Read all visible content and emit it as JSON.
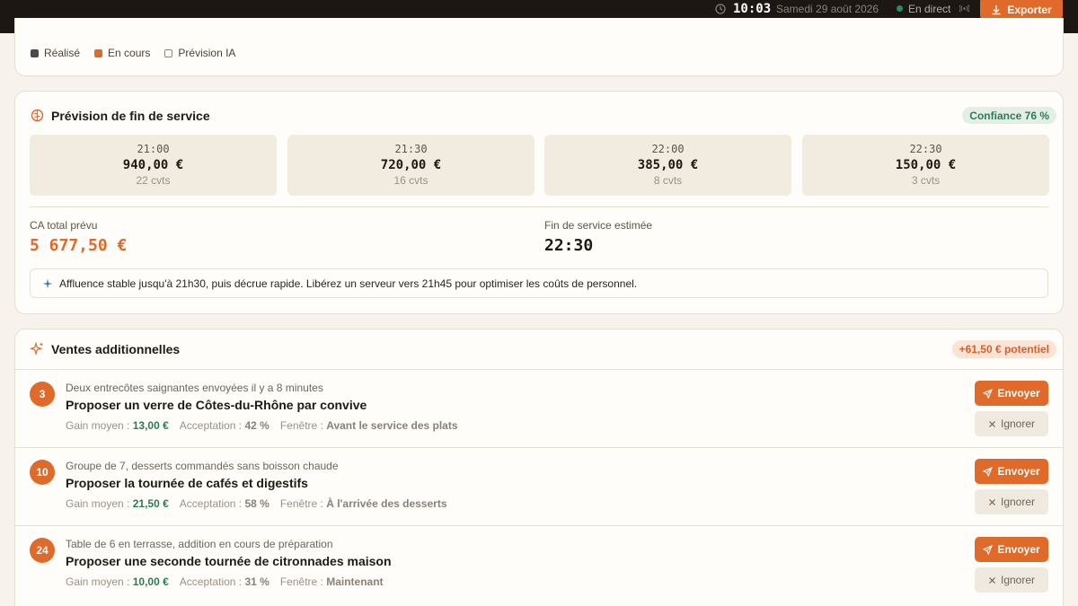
{
  "topbar": {
    "time": "10:03",
    "date": "Samedi 29 août 2026",
    "live_label": "En direct",
    "export_label": "Exporter",
    "icons": [
      "clock-icon",
      "broadcast-icon",
      "download-icon"
    ],
    "colors": {
      "accent": "#df6a2a",
      "live": "#2f8a5e",
      "bar": "#1c1713"
    }
  },
  "legend": {
    "items": [
      {
        "label": "Réalisé",
        "color": "#4a4a4a"
      },
      {
        "label": "En cours",
        "color": "#df6a2a"
      },
      {
        "label": "Prévision IA",
        "color": "#df6a2a"
      }
    ]
  },
  "forecast": {
    "title": "Prévision de fin de service",
    "confidence": "Confiance 76 %",
    "slots": [
      {
        "time": "21:00",
        "amount": "940,00 €",
        "covers": "22 cvts"
      },
      {
        "time": "21:30",
        "amount": "720,00 €",
        "covers": "16 cvts"
      },
      {
        "time": "22:00",
        "amount": "385,00 €",
        "covers": "8 cvts"
      },
      {
        "time": "22:30",
        "amount": "150,00 €",
        "covers": "3 cvts"
      }
    ],
    "total_label": "CA total prévu",
    "total_value": "5 677,50 €",
    "end_label": "Fin de service estimée",
    "end_value": "22:30",
    "insight": "Affluence stable jusqu'à 21h30, puis décrue rapide. Libérez un serveur vers 21h45 pour optimiser les coûts de personnel."
  },
  "upsell": {
    "title": "Ventes additionnelles",
    "potential": "+61,50 € potentiel",
    "send_label": "Envoyer",
    "ignore_label": "Ignorer",
    "gain_label": "Gain moyen :",
    "acceptance_label": "Acceptation :",
    "window_label": "Fenêtre :",
    "items": [
      {
        "table": "3",
        "context": "Deux entrecôtes saignantes envoyées il y a 8 minutes",
        "title": "Proposer un verre de Côtes-du-Rhône par convive",
        "gain": "13,00 €",
        "acceptance": "42 %",
        "window": "Avant le service des plats"
      },
      {
        "table": "10",
        "context": "Groupe de 7, desserts commandés sans boisson chaude",
        "title": "Proposer la tournée de cafés et digestifs",
        "gain": "21,50 €",
        "acceptance": "58 %",
        "window": "À l'arrivée des desserts"
      },
      {
        "table": "24",
        "context": "Table de 6 en terrasse, addition en cours de préparation",
        "title": "Proposer une seconde tournée de citronnades maison",
        "gain": "10,00 €",
        "acceptance": "31 %",
        "window": "Maintenant"
      }
    ]
  }
}
